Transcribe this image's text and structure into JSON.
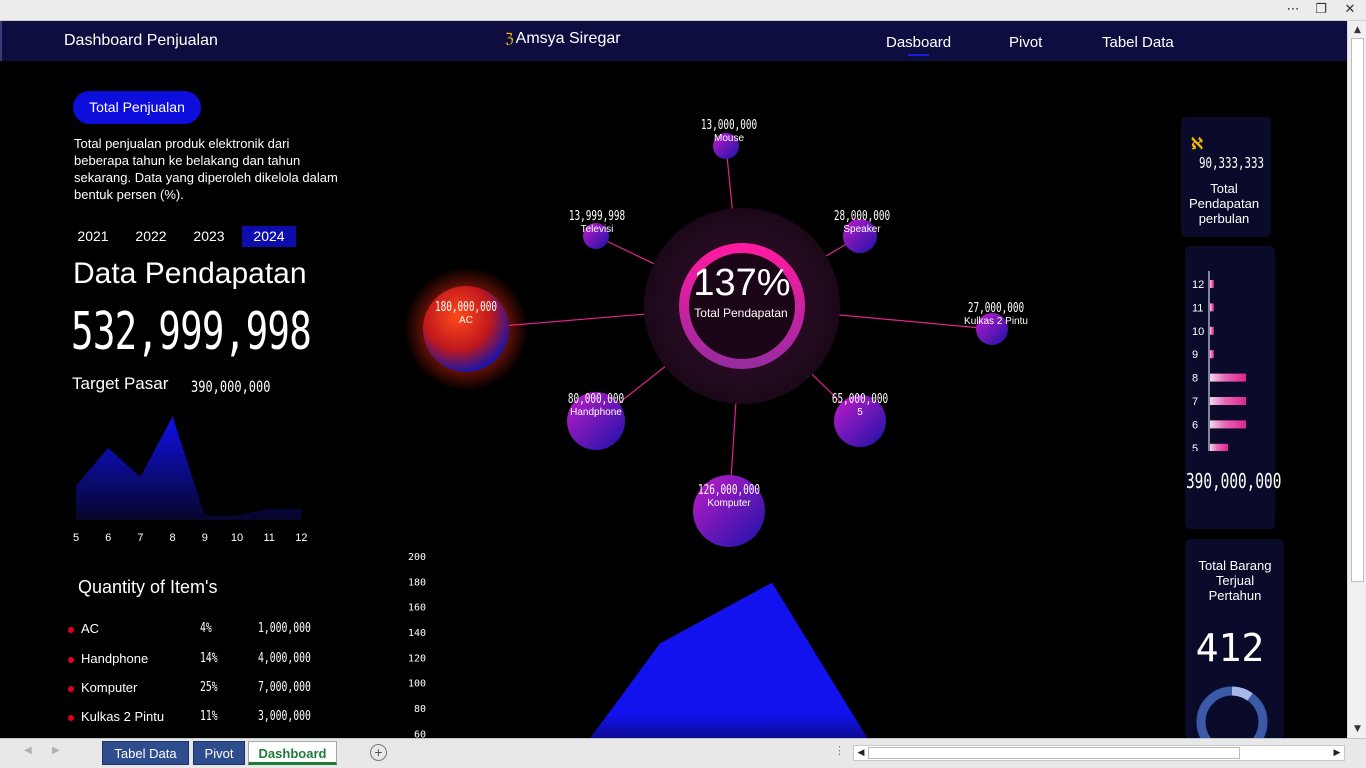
{
  "window": {
    "more_icon": "⋯",
    "restore_icon": "❐",
    "close_icon": "✕"
  },
  "navbar": {
    "title": "Dashboard Penjualan",
    "author": "Amsya Siregar",
    "author_logo": "ℨ",
    "links": {
      "dasboard": "Dasboard",
      "pivot": "Pivot",
      "tabel": "Tabel Data"
    }
  },
  "summary": {
    "pill": "Total Penjualan",
    "description": "Total penjualan produk elektronik dari beberapa tahun ke belakang dan tahun sekarang. Data yang diperoleh dikelola dalam bentuk persen (%).",
    "years": [
      "2021",
      "2022",
      "2023",
      "2024"
    ],
    "active_year": "2024",
    "data_title": "Data Pendapatan",
    "total": "532,999,998",
    "target_label": "Target Pasar",
    "target_value": "390,000,000"
  },
  "chart_data": [
    {
      "type": "area",
      "categories": [
        "5",
        "6",
        "7",
        "8",
        "9",
        "10",
        "11",
        "12"
      ],
      "values": [
        38,
        80,
        48,
        115,
        5,
        5,
        12,
        12
      ],
      "color": "#1010e8"
    },
    {
      "type": "area",
      "y_ticks": [
        "200",
        "180",
        "160",
        "140",
        "120",
        "100",
        "80",
        "60"
      ],
      "ylim": [
        50,
        200
      ],
      "x": [
        0,
        1,
        2,
        3
      ],
      "values": [
        40,
        131,
        179,
        40
      ],
      "color": "#1010e8"
    },
    {
      "type": "bar",
      "orientation": "horizontal",
      "categories": [
        "12",
        "11",
        "10",
        "9",
        "8",
        "7",
        "6",
        "5"
      ],
      "values": [
        3,
        3,
        3,
        3,
        28,
        28,
        28,
        14
      ],
      "color": "#e0238e"
    }
  ],
  "hub": {
    "percent": "137%",
    "label": "Total Pendapatan"
  },
  "bubbles": [
    {
      "value": "13,000,000",
      "name": "Mouse"
    },
    {
      "value": "13,999,998",
      "name": "Televisi"
    },
    {
      "value": "28,000,000",
      "name": "Speaker"
    },
    {
      "value": "180,000,000",
      "name": "AC"
    },
    {
      "value": "27,000,000",
      "name": "Kulkas 2 Pintu"
    },
    {
      "value": "80,000,000",
      "name": "Handphone"
    },
    {
      "value": "65,000,000",
      "name": "5"
    },
    {
      "value": "126,000,000",
      "name": "Komputer"
    }
  ],
  "quantity": {
    "title": "Quantity of Item's",
    "rows": [
      {
        "name": "AC",
        "pct": "4%",
        "value": "1,000,000"
      },
      {
        "name": "Handphone",
        "pct": "14%",
        "value": "4,000,000"
      },
      {
        "name": "Komputer",
        "pct": "25%",
        "value": "7,000,000"
      },
      {
        "name": "Kulkas 2 Pintu",
        "pct": "11%",
        "value": "3,000,000"
      }
    ]
  },
  "right": {
    "icon": "ℵ",
    "monthly_value": "90,333,333",
    "monthly_label": "Total Pendapatan perbulan",
    "bar_total": "390,000,000",
    "items_label": "Total Barang Terjual Pertahun",
    "items_value": "412"
  },
  "sheets": {
    "tabs": [
      "Tabel Data",
      "Pivot",
      "Dashboard"
    ],
    "active": "Dashboard",
    "add_icon": "+",
    "splitter_icon": "⋮",
    "prev_icon": "◀",
    "next_icon": "▶",
    "up_icon": "▲",
    "down_icon": "▼"
  }
}
